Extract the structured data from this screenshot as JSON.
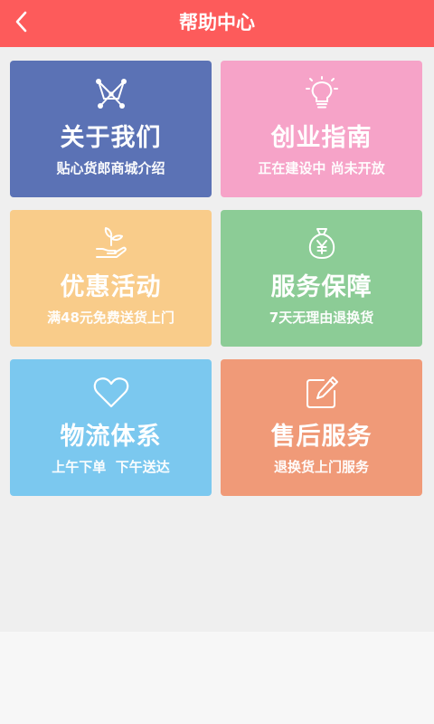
{
  "header": {
    "title": "帮助中心",
    "background": "#fd5b5b"
  },
  "cards": [
    {
      "title": "关于我们",
      "subtitle": "贴心货郎商城介绍",
      "icon": "network-nodes-icon",
      "color": "#5b72b5"
    },
    {
      "title": "创业指南",
      "subtitle": "正在建设中 尚未开放",
      "icon": "lightbulb-icon",
      "color": "#f6a3c8"
    },
    {
      "title": "优惠活动",
      "subtitle": "满48元免费送货上门",
      "icon": "plant-in-hand-icon",
      "color": "#f9cc8a"
    },
    {
      "title": "服务保障",
      "subtitle": "7天无理由退换货",
      "icon": "money-bag-icon",
      "color": "#8ccc96"
    },
    {
      "title": "物流体系",
      "subtitle": "上午下单  下午送达",
      "icon": "heart-icon",
      "color": "#7bc8ef"
    },
    {
      "title": "售后服务",
      "subtitle": "退换货上门服务",
      "icon": "edit-pen-icon",
      "color": "#f09a78"
    }
  ]
}
